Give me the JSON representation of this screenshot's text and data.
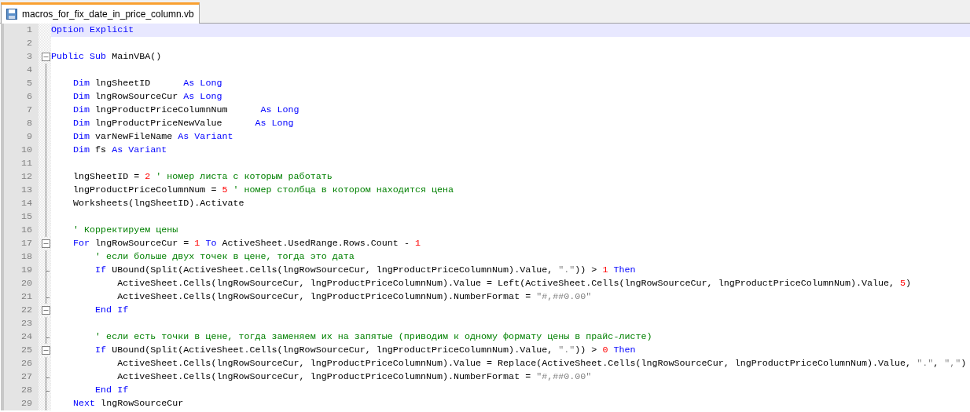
{
  "tab": {
    "label": "macros_for_fix_date_in_price_column.vb",
    "selected": true
  },
  "lines": [
    {
      "number": "1",
      "kind": "none",
      "current": true,
      "tokens": [
        {
          "kind": "keyword",
          "text": "Option Explicit"
        }
      ]
    },
    {
      "number": "2",
      "kind": "none",
      "current": false
    },
    {
      "number": "3",
      "kind": "box",
      "current": false,
      "tokens": [
        {
          "kind": "keyword",
          "text": "Public Sub"
        },
        {
          "kind": "plain",
          "text": " MainVBA()"
        }
      ],
      "children": [
        {
          "number": "4",
          "kind": "line",
          "current": false
        },
        {
          "number": "5",
          "kind": "line",
          "current": false,
          "tokens": [
            {
              "kind": "keyword",
              "text": "Dim"
            },
            {
              "kind": "plain",
              "text": " lngSheetID      "
            },
            {
              "kind": "keyword",
              "text": "As Long"
            }
          ]
        },
        {
          "number": "6",
          "kind": "line",
          "current": false,
          "tokens": [
            {
              "kind": "keyword",
              "text": "Dim"
            },
            {
              "kind": "plain",
              "text": " lngRowSourceCur "
            },
            {
              "kind": "keyword",
              "text": "As Long"
            }
          ]
        },
        {
          "number": "7",
          "kind": "line",
          "current": false,
          "tokens": [
            {
              "kind": "keyword",
              "text": "Dim"
            },
            {
              "kind": "plain",
              "text": " lngProductPriceColumnNum      "
            },
            {
              "kind": "keyword",
              "text": "As Long"
            }
          ]
        },
        {
          "number": "8",
          "kind": "line",
          "current": false,
          "tokens": [
            {
              "kind": "keyword",
              "text": "Dim"
            },
            {
              "kind": "plain",
              "text": " lngProductPriceNewValue      "
            },
            {
              "kind": "keyword",
              "text": "As Long"
            }
          ]
        },
        {
          "number": "9",
          "kind": "line",
          "current": false,
          "tokens": [
            {
              "kind": "keyword",
              "text": "Dim"
            },
            {
              "kind": "plain",
              "text": " varNewFileName "
            },
            {
              "kind": "keyword",
              "text": "As Variant"
            }
          ]
        },
        {
          "number": "10",
          "kind": "line",
          "current": false,
          "tokens": [
            {
              "kind": "keyword",
              "text": "Dim"
            },
            {
              "kind": "plain",
              "text": " fs "
            },
            {
              "kind": "keyword",
              "text": "As Variant"
            }
          ]
        },
        {
          "number": "11",
          "kind": "line",
          "current": false
        },
        {
          "number": "12",
          "kind": "line",
          "current": false,
          "tokens": [
            {
              "kind": "plain",
              "text": "lngSheetID = "
            },
            {
              "kind": "number",
              "text": "2"
            },
            {
              "kind": "comment",
              "text": " ' номер листа с которым работать"
            }
          ]
        },
        {
          "number": "13",
          "kind": "line",
          "current": false,
          "tokens": [
            {
              "kind": "plain",
              "text": "lngProductPriceColumnNum = "
            },
            {
              "kind": "number",
              "text": "5"
            },
            {
              "kind": "comment",
              "text": " ' номер столбца в котором находится цена"
            }
          ]
        },
        {
          "number": "14",
          "kind": "line",
          "current": false,
          "tokens": [
            {
              "kind": "plain",
              "text": "Worksheets(lngSheetID).Activate"
            }
          ]
        },
        {
          "number": "15",
          "kind": "line",
          "current": false
        },
        {
          "number": "16",
          "kind": "line",
          "current": false,
          "tokens": [
            {
              "kind": "comment",
              "text": "' Корректируем цены"
            }
          ]
        },
        {
          "number": "17",
          "kind": "box",
          "current": false,
          "tokens": [
            {
              "kind": "keyword",
              "text": "For"
            },
            {
              "kind": "plain",
              "text": " lngRowSourceCur = "
            },
            {
              "kind": "number",
              "text": "1"
            },
            {
              "kind": "keyword",
              "text": " To"
            },
            {
              "kind": "plain",
              "text": " ActiveSheet.UsedRange.Rows.Count - "
            },
            {
              "kind": "number",
              "text": "1"
            }
          ],
          "children": [
            {
              "number": "18",
              "kind": "line",
              "current": false,
              "tokens": [
                {
                  "kind": "comment",
                  "text": "' если больше двух точек в цене, тогда это дата"
                }
              ]
            },
            {
              "number": "19",
              "kind": "tick",
              "current": false,
              "tokens": [
                {
                  "kind": "keyword",
                  "text": "If"
                },
                {
                  "kind": "plain",
                  "text": " UBound(Split(ActiveSheet.Cells(lngRowSourceCur, lngProductPriceColumnNum).Value, "
                },
                {
                  "kind": "string",
                  "text": "\".\""
                },
                {
                  "kind": "plain",
                  "text": ")) > "
                },
                {
                  "kind": "number",
                  "text": "1"
                },
                {
                  "kind": "keyword",
                  "text": " Then"
                }
              ],
              "children": [
                {
                  "number": "20",
                  "kind": "line",
                  "current": false,
                  "tokens": [
                    {
                      "kind": "plain",
                      "text": "ActiveSheet.Cells(lngRowSourceCur, lngProductPriceColumnNum).Value = Left(ActiveSheet.Cells(lngRowSourceCur, lngProductPriceColumnNum).Value, "
                    },
                    {
                      "kind": "number",
                      "text": "5"
                    },
                    {
                      "kind": "plain",
                      "text": ")"
                    }
                  ]
                },
                {
                  "number": "21",
                  "kind": "tick",
                  "current": false,
                  "tokens": [
                    {
                      "kind": "plain",
                      "text": "ActiveSheet.Cells(lngRowSourceCur, lngProductPriceColumnNum).NumberFormat = "
                    },
                    {
                      "kind": "string",
                      "text": "\"#,##0.00\""
                    }
                  ]
                }
              ]
            },
            {
              "number": "22",
              "kind": "box",
              "current": false,
              "tokens": [
                {
                  "kind": "keyword",
                  "text": "End If"
                }
              ]
            },
            {
              "number": "23",
              "kind": "line",
              "current": false
            },
            {
              "number": "24",
              "kind": "tick",
              "current": false,
              "tokens": [
                {
                  "kind": "comment",
                  "text": "' если есть точки в цене, тогда заменяем их на запятые (приводим к одному формату цены в прайс-листе)"
                }
              ]
            },
            {
              "number": "25",
              "kind": "box",
              "current": false,
              "tokens": [
                {
                  "kind": "keyword",
                  "text": "If"
                },
                {
                  "kind": "plain",
                  "text": " UBound(Split(ActiveSheet.Cells(lngRowSourceCur, lngProductPriceColumnNum).Value, "
                },
                {
                  "kind": "string",
                  "text": "\".\""
                },
                {
                  "kind": "plain",
                  "text": ")) > "
                },
                {
                  "kind": "number",
                  "text": "0"
                },
                {
                  "kind": "keyword",
                  "text": " Then"
                }
              ],
              "children": [
                {
                  "number": "26",
                  "kind": "line",
                  "current": false,
                  "tokens": [
                    {
                      "kind": "plain",
                      "text": "ActiveSheet.Cells(lngRowSourceCur, lngProductPriceColumnNum).Value = Replace(ActiveSheet.Cells(lngRowSourceCur, lngProductPriceColumnNum).Value, "
                    },
                    {
                      "kind": "string",
                      "text": "\".\""
                    },
                    {
                      "kind": "plain",
                      "text": ", "
                    },
                    {
                      "kind": "string",
                      "text": "\",\""
                    },
                    {
                      "kind": "plain",
                      "text": ")"
                    }
                  ]
                },
                {
                  "number": "27",
                  "kind": "tick",
                  "current": false,
                  "tokens": [
                    {
                      "kind": "plain",
                      "text": "ActiveSheet.Cells(lngRowSourceCur, lngProductPriceColumnNum).NumberFormat = "
                    },
                    {
                      "kind": "string",
                      "text": "\"#,##0.00\""
                    }
                  ]
                }
              ]
            },
            {
              "number": "28",
              "kind": "tick",
              "current": false,
              "tokens": [
                {
                  "kind": "keyword",
                  "text": "End If"
                }
              ]
            }
          ]
        },
        {
          "number": "29",
          "kind": "line",
          "current": false,
          "tokens": [
            {
              "kind": "keyword",
              "text": "Next"
            },
            {
              "kind": "plain",
              "text": " lngRowSourceCur"
            }
          ]
        }
      ]
    }
  ]
}
